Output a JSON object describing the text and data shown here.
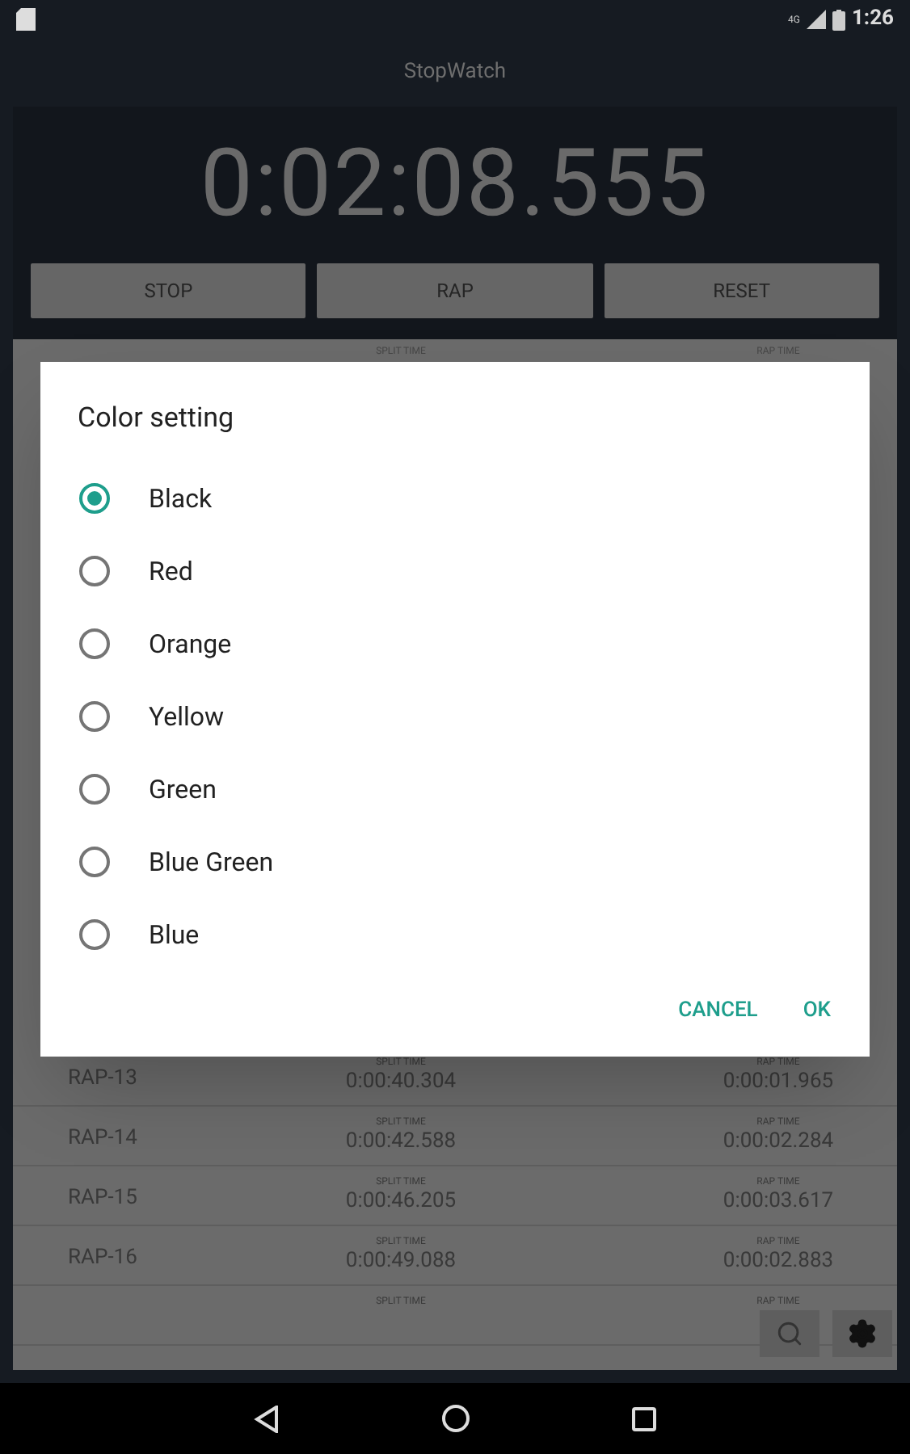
{
  "status_bar": {
    "time": "1:26",
    "network": "4G"
  },
  "app_title": "StopWatch",
  "timer": "0:02:08.555",
  "controls": [
    "STOP",
    "RAP",
    "RESET"
  ],
  "list_top": {
    "split_label": "SPLIT TIME",
    "rap_label": "RAP TIME"
  },
  "laps": [
    {
      "name": "RAP-13",
      "split_label": "SPLIT TIME",
      "split": "0:00:40.304",
      "rap_label": "RAP TIME",
      "rap": "0:00:01.965"
    },
    {
      "name": "RAP-14",
      "split_label": "SPLIT TIME",
      "split": "0:00:42.588",
      "rap_label": "RAP TIME",
      "rap": "0:00:02.284"
    },
    {
      "name": "RAP-15",
      "split_label": "SPLIT TIME",
      "split": "0:00:46.205",
      "rap_label": "RAP TIME",
      "rap": "0:00:03.617"
    },
    {
      "name": "RAP-16",
      "split_label": "SPLIT TIME",
      "split": "0:00:49.088",
      "rap_label": "RAP TIME",
      "rap": "0:00:02.883"
    },
    {
      "split_label": "SPLIT TIME",
      "rap_label": "RAP TIME"
    }
  ],
  "dialog": {
    "title": "Color setting",
    "options": [
      {
        "label": "Black",
        "selected": true
      },
      {
        "label": "Red",
        "selected": false
      },
      {
        "label": "Orange",
        "selected": false
      },
      {
        "label": "Yellow",
        "selected": false
      },
      {
        "label": "Green",
        "selected": false
      },
      {
        "label": "Blue Green",
        "selected": false
      },
      {
        "label": "Blue",
        "selected": false
      }
    ],
    "buttons": [
      "CANCEL",
      "OK"
    ]
  }
}
